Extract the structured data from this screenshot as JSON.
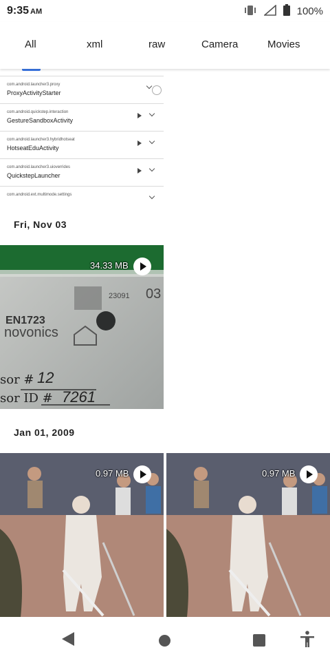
{
  "status_bar": {
    "time": "9:35",
    "ampm": "AM",
    "icons": [
      "vibrate-icon",
      "signal-icon",
      "battery-icon"
    ],
    "battery": "100%"
  },
  "tabs": [
    "All",
    "xml",
    "raw",
    "Camera",
    "Movies"
  ],
  "screenshot_list": {
    "rows": [
      {
        "package": "com.android.launcher3.proxy",
        "activity": "ProxyActivityStarter"
      },
      {
        "package": "com.android.quickstep.interaction",
        "activity": "GestureSandboxActivity"
      },
      {
        "package": "com.android.launcher3.hybridhotseat",
        "activity": "HotseatEduActivity"
      },
      {
        "package": "com.android.launcher3.uioverrides",
        "activity": "QuickstepLauncher"
      },
      {
        "package": "com.android.ext.multimode.settings",
        "activity": ""
      }
    ]
  },
  "sections": [
    {
      "date": "Fri, Nov 03",
      "items": [
        {
          "size": "34.33 MB",
          "type": "video"
        }
      ]
    },
    {
      "date": "Jan 01, 2009",
      "items": [
        {
          "size": "0.97 MB",
          "type": "video"
        },
        {
          "size": "0.97 MB",
          "type": "video"
        }
      ]
    }
  ],
  "thumb_text": {
    "model": "EN1723",
    "brand": "novonics",
    "code": "23091",
    "label_num": "03",
    "sensor_num_label": "sor #",
    "sensor_num": "12",
    "sensor_id_label": "sor ID #",
    "sensor_id": "7261"
  },
  "nav": [
    "back-icon",
    "home-icon",
    "recents-icon",
    "accessibility-icon"
  ]
}
